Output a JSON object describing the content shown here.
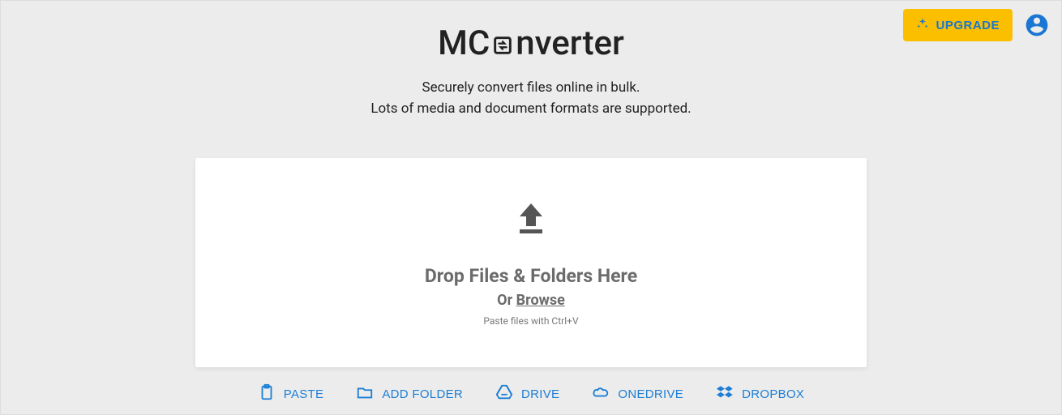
{
  "header": {
    "upgrade_label": "UPGRADE"
  },
  "brand": {
    "name_prefix": "MC",
    "name_suffix": "nverter"
  },
  "subtitle": {
    "line1": "Securely convert files online in bulk.",
    "line2": "Lots of media and document formats are supported."
  },
  "dropzone": {
    "title": "Drop Files & Folders Here",
    "or_text": "Or ",
    "browse_text": "Browse",
    "paste_hint": "Paste files with Ctrl+V"
  },
  "actions": {
    "paste": "PASTE",
    "add_folder": "ADD FOLDER",
    "drive": "DRIVE",
    "onedrive": "ONEDRIVE",
    "dropbox": "DROPBOX"
  },
  "colors": {
    "accent_blue": "#1c7ed6",
    "upgrade_bg": "#fbbf00",
    "page_bg": "#ececec",
    "card_bg": "#ffffff",
    "text_muted": "#6b6b6b"
  }
}
